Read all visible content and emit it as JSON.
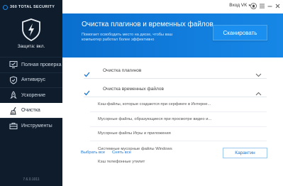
{
  "app": {
    "brand": "360 TOTAL SECURITY",
    "status": "Защита: вкл.",
    "version": "7.6.0.1011"
  },
  "nav": [
    {
      "label": "Полная проверка",
      "icon": "monitor-check-icon"
    },
    {
      "label": "Антивирус",
      "icon": "shield-icon"
    },
    {
      "label": "Ускорение",
      "icon": "rocket-icon"
    },
    {
      "label": "Очистка",
      "icon": "broom-icon"
    },
    {
      "label": "Инструменты",
      "icon": "toolbox-icon"
    }
  ],
  "topbar": {
    "login": "Вход VK",
    "icons": [
      "shirt-icon",
      "menu-icon",
      "minimize-icon",
      "close-icon"
    ]
  },
  "banner": {
    "title": "Очистка плагинов и временных файлов",
    "description": "Помогает освободить место на диске, чтобы ваш компьютер работал более эффективно",
    "scan_button": "Сканировать"
  },
  "sections": [
    {
      "label": "Очистка плагинов",
      "checked": true,
      "expanded": false
    },
    {
      "label": "Очистка временных файлов",
      "checked": true,
      "expanded": true
    }
  ],
  "temp_items": [
    "Кэш-файлы, которые создаются при серфинге в Интерне...",
    "Мусорные файлы, образующиеся при просмотре видео и...",
    "Мусорные файлы Игры и приложения",
    "Системные мусорные файлы Windows",
    "Кэш телефонные утилит"
  ],
  "footer": {
    "select_all": "Выбрать все",
    "deselect_all": "Снять все",
    "quarantine": "Карантин"
  },
  "colors": {
    "sidebar": "#0f1c2c",
    "accent": "#1787e6",
    "check": "#1976d2"
  }
}
